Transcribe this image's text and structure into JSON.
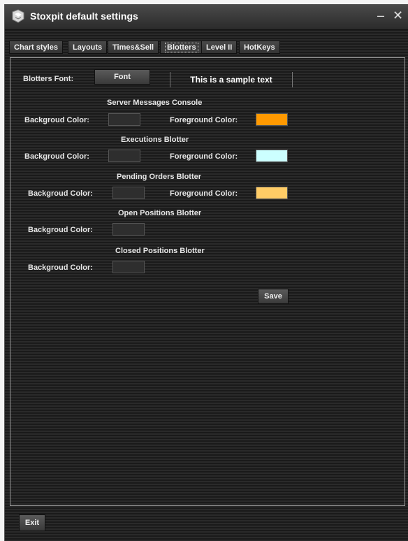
{
  "window": {
    "title": "Stoxpit default settings",
    "minimize_label": "–",
    "close_label": "✕"
  },
  "tabs": [
    {
      "label": "Chart styles"
    },
    {
      "label": "Layouts"
    },
    {
      "label": "Times&Sell"
    },
    {
      "label": "Blotters",
      "active": true
    },
    {
      "label": "Level II"
    },
    {
      "label": "HotKeys"
    }
  ],
  "font_row": {
    "label": "Blotters Font:",
    "button_label": "Font",
    "sample_text": "This is a sample text"
  },
  "sections": [
    {
      "title": "Server Messages Console",
      "bg_label": "Backgroud Color:",
      "bg_color": "#2e2e2e",
      "fg_label": "Foreground Color:",
      "fg_color": "#ff9900"
    },
    {
      "title": "Executions Blotter",
      "bg_label": "Backgroud Color:",
      "bg_color": "#2e2e2e",
      "fg_label": "Foreground Color:",
      "fg_color": "#ccffff"
    },
    {
      "title": "Pending Orders Blotter",
      "bg_label": "Backgroud Color:",
      "bg_color": "#2e2e2e",
      "fg_label": "Foreground Color:",
      "fg_color": "#ffcc66"
    },
    {
      "title": "Open Positions Blotter",
      "bg_label": "Backgroud Color:",
      "bg_color": "#2e2e2e"
    },
    {
      "title": "Closed Positions Blotter",
      "bg_label": "Backgroud Color:",
      "bg_color": "#2e2e2e"
    }
  ],
  "save_label": "Save",
  "exit_label": "Exit"
}
